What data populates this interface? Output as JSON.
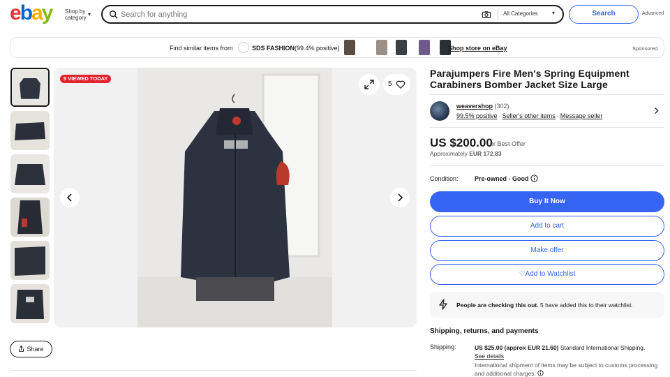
{
  "header": {
    "logo_letters": [
      {
        "ch": "e",
        "color": "#e53238"
      },
      {
        "ch": "b",
        "color": "#0064d2"
      },
      {
        "ch": "a",
        "color": "#f5af02"
      },
      {
        "ch": "y",
        "color": "#86b817"
      }
    ],
    "shop_by_line1": "Shop by",
    "shop_by_line2": "category",
    "search_placeholder": "Search for anything",
    "category_select": "All Categories",
    "search_button": "Search",
    "advanced_link": "Advanced"
  },
  "store_banner": {
    "find_similar": "Find similar items from",
    "store_name": "SDS FASHION",
    "store_positive": "(99.4% positive)",
    "shop_store_link": "Shop store on eBay",
    "sponsored": "Sponsored"
  },
  "gallery": {
    "viewed_badge": "5 VIEWED TODAY",
    "watch_count": "5",
    "thumbnail_count": 7
  },
  "share_button": "Share",
  "listing": {
    "title": "Parajumpers Fire Men's Spring Equipment Carabiners Bomber Jacket Size Large",
    "seller": {
      "name": "weavershop",
      "feedback_count": "(302)",
      "positive": "99.5% positive",
      "other_items": "Seller's other items",
      "message": "Message seller"
    },
    "price": "US $200.00",
    "best_offer": "or Best Offer",
    "approx_prefix": "Approximately",
    "approx_value": "EUR 172.83",
    "condition_label": "Condition:",
    "condition_value": "Pre-owned - Good",
    "buy_now": "Buy It Now",
    "add_to_cart": "Add to cart",
    "make_offer": "Make offer",
    "add_to_watchlist": "Add to Watchlist",
    "info_bold": "People are checking this out.",
    "info_rest": "5 have added this to their watchlist.",
    "shipping_heading": "Shipping, returns, and payments",
    "shipping_label": "Shipping:",
    "shipping_cost": "US $25.00 (approx EUR 21.60)",
    "shipping_method": "Standard International Shipping.",
    "see_details": "See details",
    "shipping_note": "International shipment of items may be subject to customs processing and additional charges."
  },
  "colors": {
    "brand_blue": "#3665f3",
    "badge_red": "#e0232e"
  }
}
